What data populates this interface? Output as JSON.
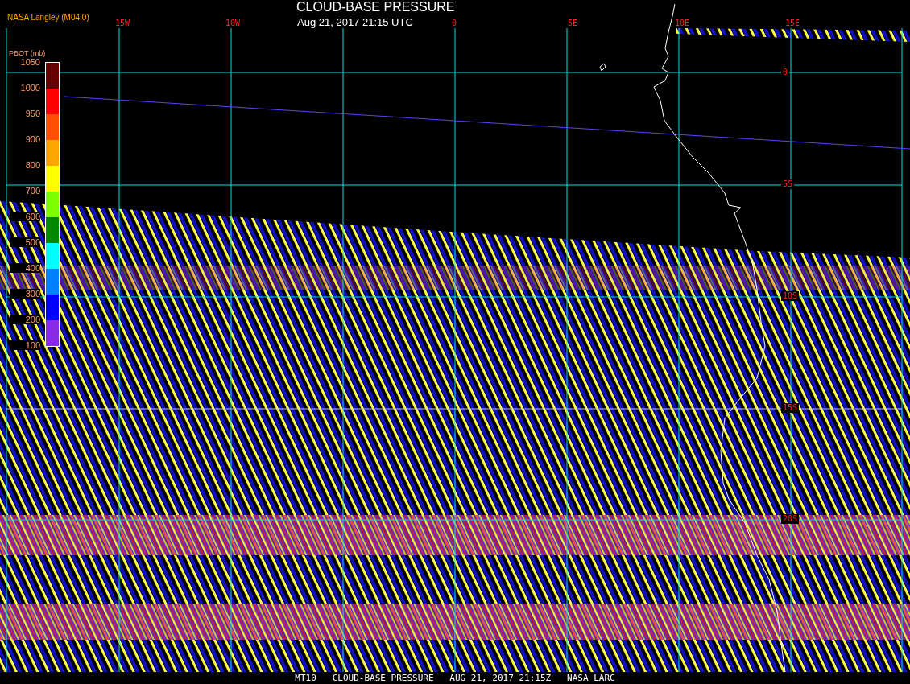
{
  "header": {
    "title": "CLOUD-BASE PRESSURE",
    "datetime": "Aug 21, 2017 21:15 UTC",
    "source": "NASA Langley (M04.0)"
  },
  "legend": {
    "title": "PBOT (mb)",
    "labels": [
      "1050",
      "1000",
      "950",
      "900",
      "800",
      "700",
      "600",
      "500",
      "400",
      "300",
      "200",
      "100"
    ],
    "segments": [
      {
        "color": "#660000"
      },
      {
        "color": "#ff0000"
      },
      {
        "color": "#ff5000"
      },
      {
        "color": "#ffa500"
      },
      {
        "color": "#ffff00"
      },
      {
        "color": "#80ff00"
      },
      {
        "color": "#008800"
      },
      {
        "color": "#00ffff"
      },
      {
        "color": "#0080ff"
      },
      {
        "color": "#0000ff"
      },
      {
        "color": "#8a2be2"
      }
    ]
  },
  "map": {
    "lon_labels": [
      "15W",
      "10W",
      "0",
      "5E",
      "10E",
      "15E"
    ],
    "lat_labels": [
      "0",
      "5S",
      "10S",
      "15S",
      "20S"
    ]
  },
  "footer": "MT10   CLOUD-BASE PRESSURE   AUG 21, 2017 21:15Z   NASA LARC"
}
